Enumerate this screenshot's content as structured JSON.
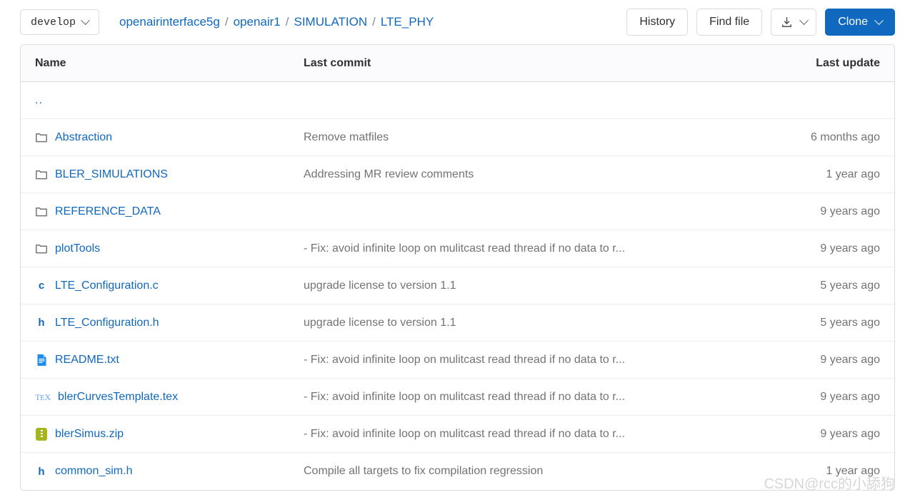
{
  "toolbar": {
    "branch_label": "develop",
    "branch_icon": "chevron-down-icon",
    "breadcrumb": {
      "items": [
        "openairinterface5g",
        "openair1",
        "SIMULATION",
        "LTE_PHY"
      ],
      "separator": "/"
    },
    "history_label": "History",
    "find_file_label": "Find file",
    "download_icon": "download-icon",
    "download_chevron_icon": "chevron-down-icon",
    "clone_label": "Clone",
    "clone_chevron_icon": "chevron-down-icon",
    "clone_bg_color": "#1068bf"
  },
  "table": {
    "headers": {
      "name": "Name",
      "last_commit": "Last commit",
      "last_update": "Last update"
    },
    "parent_row": {
      "label": "..",
      "commit": "",
      "update": ""
    },
    "rows": [
      {
        "icon": "folder-icon",
        "name": "Abstraction",
        "commit": "Remove matfiles",
        "update": "6 months ago"
      },
      {
        "icon": "folder-icon",
        "name": "BLER_SIMULATIONS",
        "commit": "Addressing MR review comments",
        "update": "1 year ago"
      },
      {
        "icon": "folder-icon",
        "name": "REFERENCE_DATA",
        "commit": "",
        "update": "9 years ago"
      },
      {
        "icon": "folder-icon",
        "name": "plotTools",
        "commit": "- Fix: avoid infinite loop on mulitcast read thread if no data to r...",
        "update": "9 years ago"
      },
      {
        "icon": "c-file-icon",
        "name": "LTE_Configuration.c",
        "commit": "upgrade license to version 1.1",
        "update": "5 years ago"
      },
      {
        "icon": "h-file-icon",
        "name": "LTE_Configuration.h",
        "commit": "upgrade license to version 1.1",
        "update": "5 years ago"
      },
      {
        "icon": "text-file-icon",
        "name": "README.txt",
        "commit": "- Fix: avoid infinite loop on mulitcast read thread if no data to r...",
        "update": "9 years ago"
      },
      {
        "icon": "tex-file-icon",
        "name": "blerCurvesTemplate.tex",
        "commit": "- Fix: avoid infinite loop on mulitcast read thread if no data to r...",
        "update": "9 years ago"
      },
      {
        "icon": "zip-file-icon",
        "name": "blerSimus.zip",
        "commit": "- Fix: avoid infinite loop on mulitcast read thread if no data to r...",
        "update": "9 years ago"
      },
      {
        "icon": "h-file-icon",
        "name": "common_sim.h",
        "commit": "Compile all targets to fix compilation regression",
        "update": "1 year ago"
      }
    ]
  },
  "watermark": {
    "text": "CSDN@rcc的小舔狗"
  },
  "colors": {
    "link": "#1068bf",
    "muted_text": "#737278",
    "heading_text": "#303030",
    "border": "#dcdcdc",
    "row_border": "#ececef",
    "header_bg": "#fbfafd",
    "zip_icon": "#a6b420",
    "tex_icon": "#63a6e9"
  }
}
